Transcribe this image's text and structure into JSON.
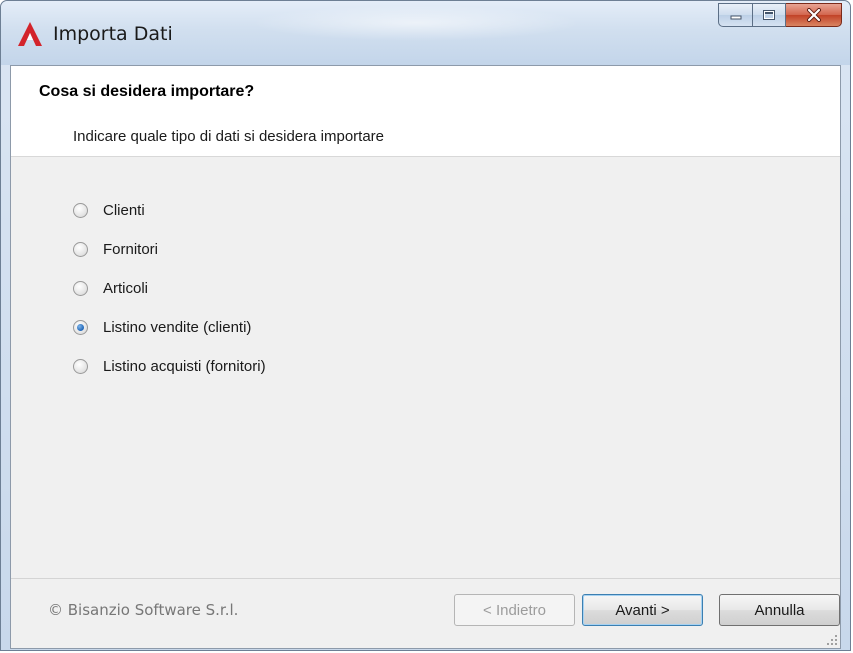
{
  "window": {
    "title": "Importa Dati",
    "accent_color": "#d3242b"
  },
  "header": {
    "title": "Cosa si desidera importare?",
    "subtitle": "Indicare quale tipo di dati si desidera importare"
  },
  "options": {
    "items": [
      {
        "label": "Clienti",
        "checked": false
      },
      {
        "label": "Fornitori",
        "checked": false
      },
      {
        "label": "Articoli",
        "checked": false
      },
      {
        "label": "Listino vendite (clienti)",
        "checked": true
      },
      {
        "label": "Listino acquisti (fornitori)",
        "checked": false
      }
    ]
  },
  "footer": {
    "copyright": "© Bisanzio Software S.r.l.",
    "back_label": "< Indietro",
    "next_label": "Avanti >",
    "cancel_label": "Annulla"
  },
  "icons": {
    "app": "app-logo-icon",
    "minimize": "minimize-icon",
    "maximize": "maximize-icon",
    "close": "close-icon",
    "resize": "resize-grip-icon"
  }
}
